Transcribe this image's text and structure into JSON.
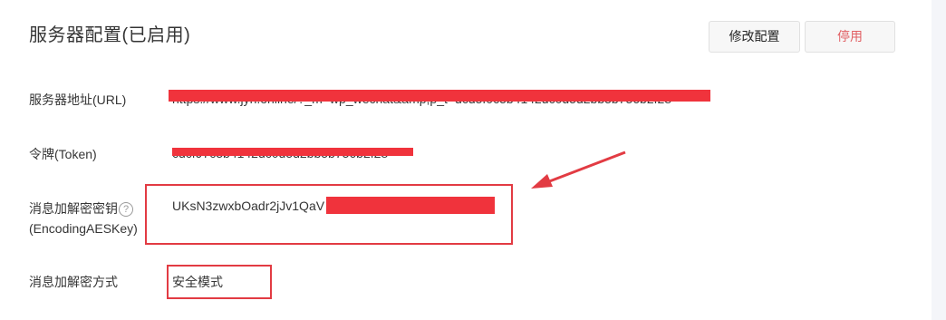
{
  "header": {
    "title": "服务器配置(已启用)",
    "edit_label": "修改配置",
    "disable_label": "停用"
  },
  "fields": {
    "url_label": "服务器地址(URL)",
    "url_value": "https://www.jyh.online/?_m=wp_wechat&amp;p_t=dcd5f0c5b4142dc0d5d2bb5b756b2f28",
    "token_label": "令牌(Token)",
    "token_value": "cdcf97c3b4142dc0d5d2bb5b756b2f28",
    "aes_label_line1": "消息加解密密钥",
    "aes_label_line2": "(EncodingAESKey)",
    "aes_help": "?",
    "aes_value": "UKsN3zwxbOadr2jJv1QaV",
    "mode_label": "消息加解密方式",
    "mode_value": "安全模式"
  },
  "colors": {
    "accent_red": "#e15f63",
    "redaction": "#f0333c",
    "annotation": "#e23b43"
  }
}
